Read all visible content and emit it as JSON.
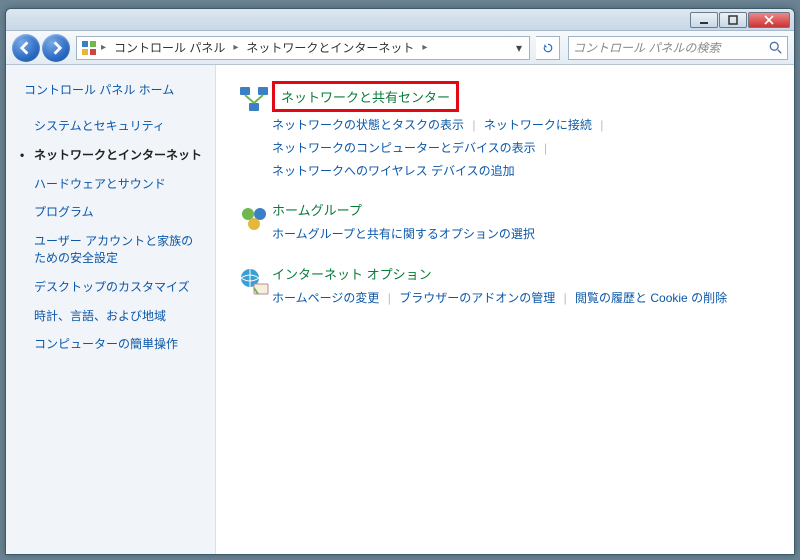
{
  "breadcrumb": {
    "seg1": "コントロール パネル",
    "seg2": "ネットワークとインターネット"
  },
  "search": {
    "placeholder": "コントロール パネルの検索"
  },
  "sidebar": {
    "home": "コントロール パネル ホーム",
    "items": [
      {
        "label": "システムとセキュリティ"
      },
      {
        "label": "ネットワークとインターネット"
      },
      {
        "label": "ハードウェアとサウンド"
      },
      {
        "label": "プログラム"
      },
      {
        "label": "ユーザー アカウントと家族のための安全設定"
      },
      {
        "label": "デスクトップのカスタマイズ"
      },
      {
        "label": "時計、言語、および地域"
      },
      {
        "label": "コンピューターの簡単操作"
      }
    ]
  },
  "sections": [
    {
      "title": "ネットワークと共有センター",
      "highlighted": true,
      "links": [
        "ネットワークの状態とタスクの表示",
        "ネットワークに接続",
        "ネットワークのコンピューターとデバイスの表示",
        "ネットワークへのワイヤレス デバイスの追加"
      ]
    },
    {
      "title": "ホームグループ",
      "links": [
        "ホームグループと共有に関するオプションの選択"
      ]
    },
    {
      "title": "インターネット オプション",
      "links": [
        "ホームページの変更",
        "ブラウザーのアドオンの管理",
        "閲覧の履歴と Cookie の削除"
      ]
    }
  ]
}
